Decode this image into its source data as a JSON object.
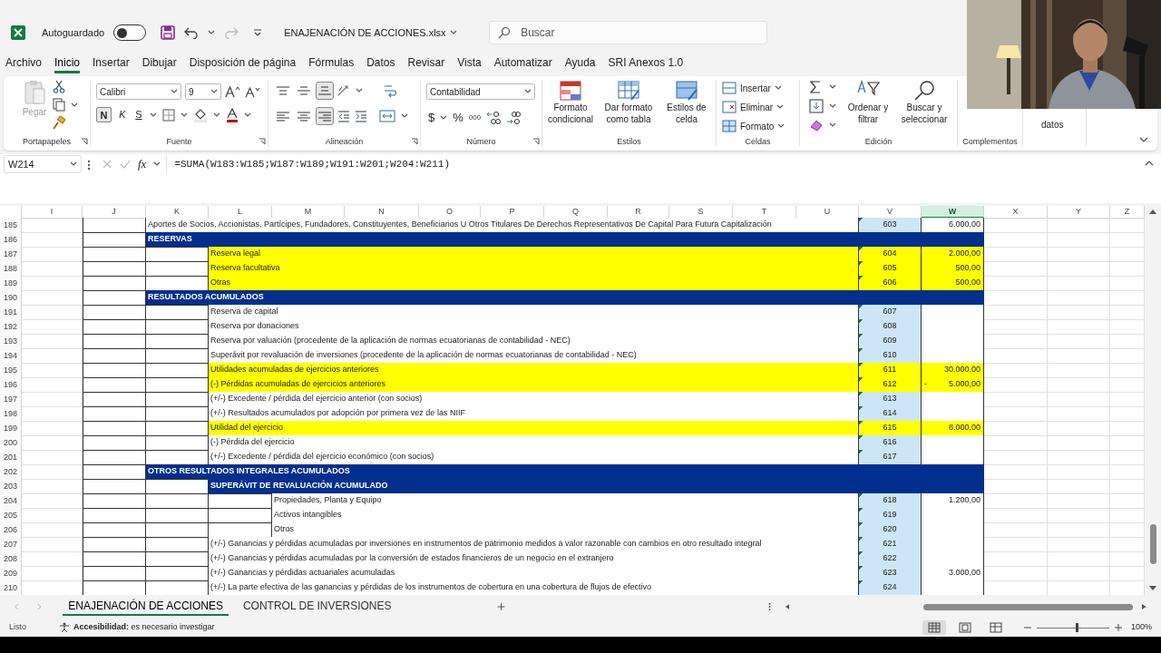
{
  "titlebar": {
    "autosave_label": "Autoguardado",
    "autosave_on": false,
    "file_name": "ENAJENACIÓN DE ACCIONES.xlsx",
    "search_placeholder": "Buscar"
  },
  "menu_tabs": [
    {
      "label": "Archivo",
      "selected": false
    },
    {
      "label": "Inicio",
      "selected": true
    },
    {
      "label": "Insertar",
      "selected": false
    },
    {
      "label": "Dibujar",
      "selected": false
    },
    {
      "label": "Disposición de página",
      "selected": false
    },
    {
      "label": "Fórmulas",
      "selected": false
    },
    {
      "label": "Datos",
      "selected": false
    },
    {
      "label": "Revisar",
      "selected": false
    },
    {
      "label": "Vista",
      "selected": false
    },
    {
      "label": "Automatizar",
      "selected": false
    },
    {
      "label": "Ayuda",
      "selected": false
    },
    {
      "label": "SRI Anexos 1.0",
      "selected": false
    }
  ],
  "ribbon": {
    "clipboard": {
      "paste": "Pegar",
      "paste_disabled": true,
      "label": "Portapapeles"
    },
    "font": {
      "name": "Calibri",
      "size": "9",
      "bold": {
        "label": "N",
        "selected": true
      },
      "italic": "K",
      "underline": "S",
      "label": "Fuente"
    },
    "alignment": {
      "vertical": [
        {
          "kind": "top",
          "selected": false
        },
        {
          "kind": "middle",
          "selected": false
        },
        {
          "kind": "bottom",
          "selected": true
        }
      ],
      "horizontal": [
        {
          "kind": "left",
          "selected": false
        },
        {
          "kind": "center",
          "selected": false
        },
        {
          "kind": "right",
          "selected": true
        }
      ],
      "label": "Alineación"
    },
    "number": {
      "format": "Contabilidad",
      "currency": "$",
      "percent": "%",
      "thousands": "000",
      "label": "Número"
    },
    "styles": {
      "buttons": [
        "Formato condicional",
        "Dar formato como tabla",
        "Estilos de celda"
      ],
      "label": "Estilos"
    },
    "cells": {
      "buttons": [
        "Insertar",
        "Eliminar",
        "Formato"
      ],
      "label": "Celdas"
    },
    "editing": {
      "buttons": [
        "Ordenar y filtrar",
        "Buscar y seleccionar"
      ],
      "label": "Edición"
    },
    "addins": {
      "label": "Complementos"
    },
    "analyze": {
      "button": "datos"
    }
  },
  "formula_bar": {
    "cell": "W214",
    "fx": "fx",
    "formula": "=SUMA(W183:W185;W187:W189;W191:W201;W204:W211)"
  },
  "columns": [
    {
      "label": "I",
      "selected": false
    },
    {
      "label": "J",
      "selected": false
    },
    {
      "label": "K",
      "selected": false
    },
    {
      "label": "L",
      "selected": false
    },
    {
      "label": "M",
      "selected": false
    },
    {
      "label": "N",
      "selected": false
    },
    {
      "label": "O",
      "selected": false
    },
    {
      "label": "P",
      "selected": false
    },
    {
      "label": "Q",
      "selected": false
    },
    {
      "label": "R",
      "selected": false
    },
    {
      "label": "S",
      "selected": false
    },
    {
      "label": "T",
      "selected": false
    },
    {
      "label": "U",
      "selected": false
    },
    {
      "label": "V",
      "selected": false
    },
    {
      "label": "W",
      "selected": true
    },
    {
      "label": "X",
      "selected": false
    },
    {
      "label": "Y",
      "selected": false
    },
    {
      "label": "Z",
      "selected": false
    }
  ],
  "rows": [
    {
      "row": "185",
      "kind": "lead",
      "text": "Aportes de Socios, Accionistas, Partícipes, Fundadores, Constituyentes, Beneficiarios U Otros Titulares De Derechos Representativos De Capital Para Futura Capitalización",
      "code": "603",
      "amount": "6.000,00",
      "highlighted": false
    },
    {
      "row": "186",
      "kind": "section",
      "text": "RESERVAS"
    },
    {
      "row": "187",
      "kind": "item",
      "text": "Reserva legal",
      "code": "604",
      "amount": "2.000,00",
      "highlighted": true
    },
    {
      "row": "188",
      "kind": "item",
      "text": "Reserva facultativa",
      "code": "605",
      "amount": "500,00",
      "highlighted": true
    },
    {
      "row": "189",
      "kind": "item",
      "text": "Otras",
      "code": "606",
      "amount": "500,00",
      "highlighted": true
    },
    {
      "row": "190",
      "kind": "section",
      "text": "RESULTADOS ACUMULADOS"
    },
    {
      "row": "191",
      "kind": "item",
      "text": "Reserva de capital",
      "code": "607",
      "highlighted": false
    },
    {
      "row": "192",
      "kind": "item",
      "text": "Reserva por donaciones",
      "code": "608",
      "highlighted": false
    },
    {
      "row": "193",
      "kind": "item",
      "text": "Reserva por valuación (procedente de la aplicación de normas ecuatorianas de contabilidad - NEC)",
      "code": "609",
      "highlighted": false
    },
    {
      "row": "194",
      "kind": "item",
      "text": "Superávit por revaluación de inversiones (procedente de la aplicación de normas ecuatorianas de contabilidad - NEC)",
      "code": "610",
      "highlighted": false
    },
    {
      "row": "195",
      "kind": "item",
      "text": "Utilidades acumuladas de ejercicios anteriores",
      "code": "611",
      "amount": "30.000,00",
      "highlighted": true
    },
    {
      "row": "196",
      "kind": "item",
      "text": "(-) Pérdidas acumuladas de ejercicios anteriores",
      "code": "612",
      "sign": "-",
      "amount": "5.000,00",
      "highlighted": true
    },
    {
      "row": "197",
      "kind": "item",
      "text": "(+/-) Excedente / pérdida del ejercicio anterior (con socios)",
      "code": "613",
      "highlighted": false
    },
    {
      "row": "198",
      "kind": "item",
      "text": "(+/-) Resultados acumulados por adopción por primera vez de las NIIF",
      "code": "614",
      "highlighted": false
    },
    {
      "row": "199",
      "kind": "item",
      "text": "Utilidad del ejercicio",
      "code": "615",
      "amount": "8.000,00",
      "highlighted": true
    },
    {
      "row": "200",
      "kind": "item",
      "text": "(-) Pérdida del ejercicio",
      "code": "616",
      "highlighted": false
    },
    {
      "row": "201",
      "kind": "item",
      "text": "(+/-) Excedente / pérdida del ejercicio económico (con socios)",
      "code": "617",
      "highlighted": false
    },
    {
      "row": "202",
      "kind": "section",
      "text": "OTROS RESULTADOS INTEGRALES ACUMULADOS"
    },
    {
      "row": "203",
      "kind": "subsection",
      "text": "SUPERÁVIT DE REVALUACIÓN ACUMULADO"
    },
    {
      "row": "204",
      "kind": "subitem",
      "text": "Propiedades, Planta y Equipo",
      "code": "618",
      "amount": "1.200,00",
      "highlighted": false
    },
    {
      "row": "205",
      "kind": "subitem",
      "text": "Activos intangibles",
      "code": "619",
      "highlighted": false
    },
    {
      "row": "206",
      "kind": "subitem",
      "text": "Otros",
      "code": "620",
      "highlighted": false
    },
    {
      "row": "207",
      "kind": "item",
      "text": "(+/-) Ganancias y pérdidas acumuladas por inversiones en instrumentos de patrimonio medidos a valor razonable con cambios en otro resultado integral",
      "code": "621",
      "highlighted": false
    },
    {
      "row": "208",
      "kind": "item",
      "text": "(+/-) Ganancias y pérdidas acumuladas por la conversión de estados financieros de un negocio en el extranjero",
      "code": "622",
      "highlighted": false
    },
    {
      "row": "209",
      "kind": "item",
      "text": "(+/-) Ganancias y pérdidas actuariales acumuladas",
      "code": "623",
      "amount": "3.000,00",
      "highlighted": false
    },
    {
      "row": "210",
      "kind": "item",
      "text": "(+/-) La parte efectiva de las ganancias y pérdidas de los instrumentos de cobertura en una cobertura de flujos de efectivo",
      "code": "624",
      "highlighted": false
    }
  ],
  "sheet_tabs": [
    {
      "label": "ENAJENACIÓN DE ACCIONES",
      "selected": true
    },
    {
      "label": "CONTROL DE INVERSIONES",
      "selected": false
    }
  ],
  "status_bar": {
    "ready": "Listo",
    "accessibility": "**Accesibilidad:** es necesario investigar",
    "views": [
      {
        "kind": "normal",
        "selected": true
      },
      {
        "kind": "layout",
        "selected": false
      },
      {
        "kind": "pagebreak",
        "selected": false
      }
    ],
    "zoom_slider": {
      "level": 0.55
    },
    "zoom": "100%"
  }
}
